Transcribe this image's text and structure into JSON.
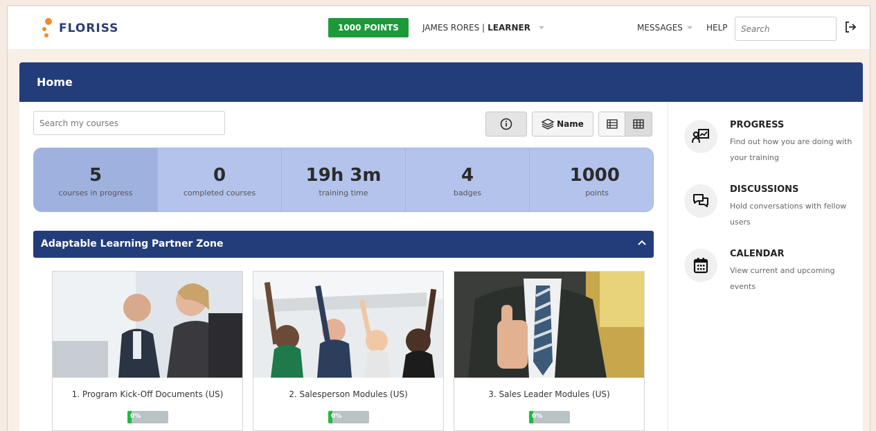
{
  "header": {
    "logo_text": "FLORISS",
    "points_badge": "1000 POINTS",
    "user_name": "JAMES RORES |",
    "user_role": "LEARNER",
    "messages_label": "MESSAGES",
    "help_label": "HELP",
    "search_placeholder": "Search"
  },
  "home": {
    "title": "Home",
    "course_search_placeholder": "Search my courses",
    "sort_label": "Name"
  },
  "stats": [
    {
      "value": "5",
      "label": "courses in progress"
    },
    {
      "value": "0",
      "label": "completed courses"
    },
    {
      "value": "19h 3m",
      "label": "training time"
    },
    {
      "value": "4",
      "label": "badges"
    },
    {
      "value": "1000",
      "label": "points"
    }
  ],
  "zone": {
    "title": "Adaptable Learning Partner Zone"
  },
  "courses": [
    {
      "title": "1. Program Kick-Off Documents (US)",
      "progress": 0,
      "progress_label": "0%"
    },
    {
      "title": "2. Salesperson Modules (US)",
      "progress": 0,
      "progress_label": "0%"
    },
    {
      "title": "3. Sales Leader Modules (US)",
      "progress": 0,
      "progress_label": "0%"
    }
  ],
  "sidebar": [
    {
      "title": "PROGRESS",
      "description": "Find out how you are doing with your training",
      "icon": "progress-chart-icon"
    },
    {
      "title": "DISCUSSIONS",
      "description": "Hold conversations with fellow users",
      "icon": "chat-bubbles-icon"
    },
    {
      "title": "CALENDAR",
      "description": "View current and upcoming events",
      "icon": "calendar-icon"
    }
  ],
  "colors": {
    "brand_navy": "#233d7a",
    "points_green": "#1b9a3a",
    "stats_blue": "#b3c3ec",
    "progress_green": "#1fba45",
    "logo_orange": "#f28b24"
  }
}
